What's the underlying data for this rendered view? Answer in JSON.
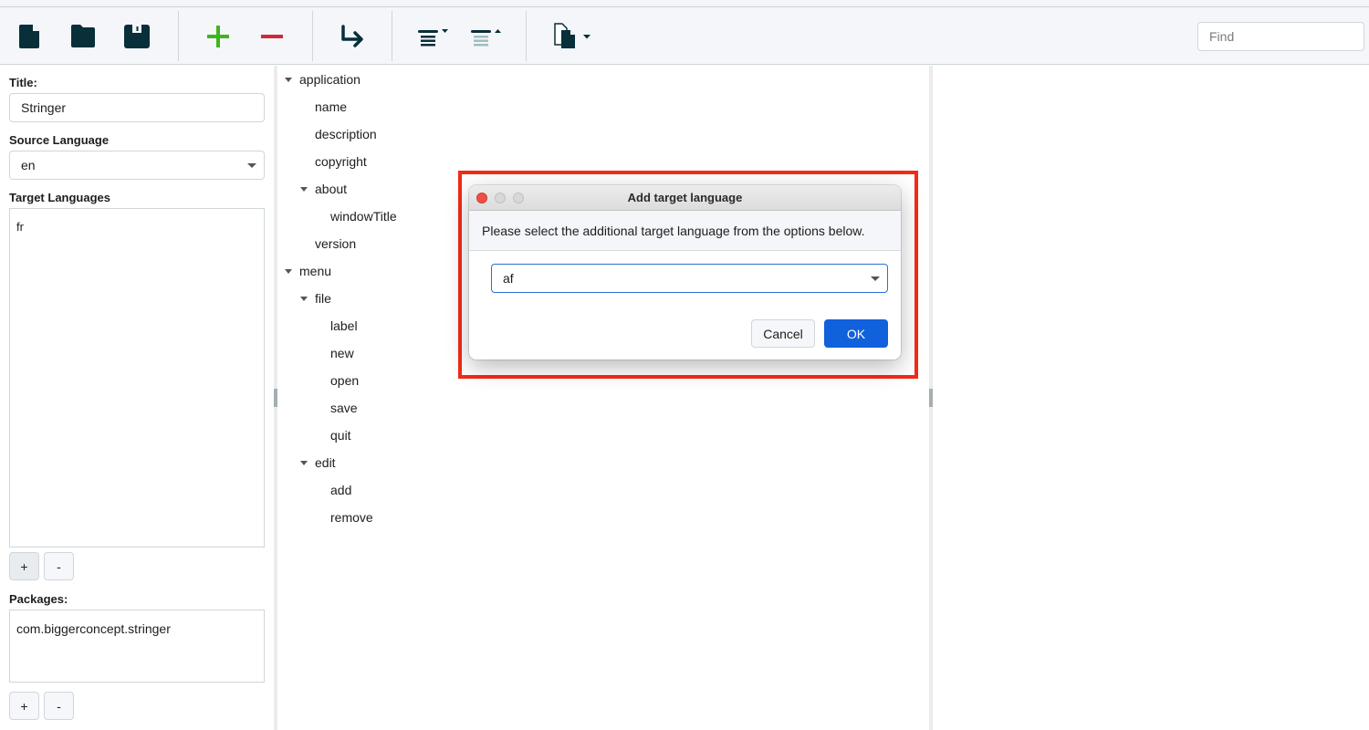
{
  "toolbar": {
    "buttons": [
      {
        "name": "new-file",
        "icon": "new-file-icon"
      },
      {
        "name": "open-folder",
        "icon": "folder-icon"
      },
      {
        "name": "save",
        "icon": "save-icon"
      },
      {
        "name": "add",
        "icon": "plus-icon"
      },
      {
        "name": "remove",
        "icon": "minus-icon"
      },
      {
        "name": "indent",
        "icon": "arrow-turn-right-icon"
      },
      {
        "name": "expand-all",
        "icon": "expand-list-icon"
      },
      {
        "name": "collapse-all",
        "icon": "collapse-list-icon"
      },
      {
        "name": "export",
        "icon": "copy-files-dropdown-icon"
      }
    ],
    "find_placeholder": "Find",
    "colors": {
      "icon": "#082f3a",
      "add": "#3fb51c",
      "remove": "#d02a3a",
      "collapse": "#9fc0bd"
    }
  },
  "left_panel": {
    "title_label": "Title:",
    "title_value": "Stringer",
    "source_language_label": "Source Language",
    "source_language_value": "en",
    "target_languages_label": "Target Languages",
    "target_languages": [
      "fr"
    ],
    "add_label": "+",
    "remove_label": "-",
    "packages_label": "Packages:",
    "packages": [
      "com.biggerconcept.stringer"
    ]
  },
  "tree": {
    "nodes": [
      {
        "label": "application",
        "level": 0,
        "expandable": true
      },
      {
        "label": "name",
        "level": 1,
        "expandable": false
      },
      {
        "label": "description",
        "level": 1,
        "expandable": false
      },
      {
        "label": "copyright",
        "level": 1,
        "expandable": false
      },
      {
        "label": "about",
        "level": 1,
        "expandable": true
      },
      {
        "label": "windowTitle",
        "level": 2,
        "expandable": false
      },
      {
        "label": "version",
        "level": 1,
        "expandable": false
      },
      {
        "label": "menu",
        "level": 0,
        "expandable": true
      },
      {
        "label": "file",
        "level": 1,
        "expandable": true
      },
      {
        "label": "label",
        "level": 2,
        "expandable": false
      },
      {
        "label": "new",
        "level": 2,
        "expandable": false
      },
      {
        "label": "open",
        "level": 2,
        "expandable": false
      },
      {
        "label": "save",
        "level": 2,
        "expandable": false
      },
      {
        "label": "quit",
        "level": 2,
        "expandable": false
      },
      {
        "label": "edit",
        "level": 1,
        "expandable": true
      },
      {
        "label": "add",
        "level": 2,
        "expandable": false
      },
      {
        "label": "remove",
        "level": 2,
        "expandable": false
      }
    ]
  },
  "dialog": {
    "title": "Add target language",
    "message": "Please select the additional target language from the options below.",
    "selected_language": "af",
    "cancel_label": "Cancel",
    "ok_label": "OK",
    "colors": {
      "ok": "#1160dc",
      "highlight": "#f42a17",
      "close": "#ee4e45"
    }
  }
}
